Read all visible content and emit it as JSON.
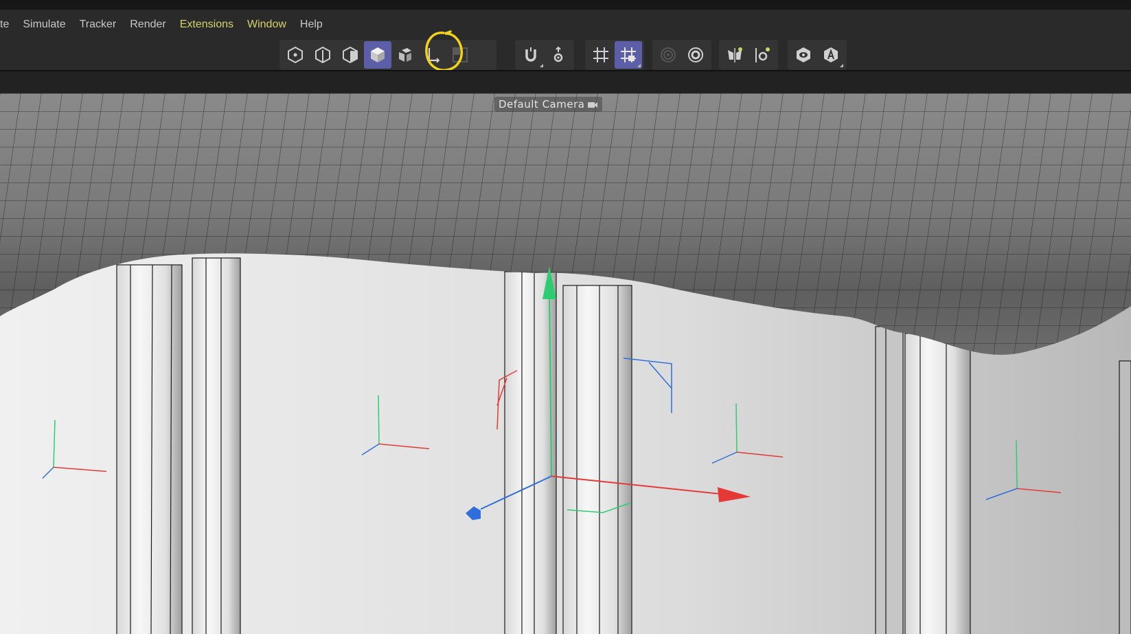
{
  "menu": {
    "items": [
      {
        "label": "te"
      },
      {
        "label": "Simulate"
      },
      {
        "label": "Tracker"
      },
      {
        "label": "Render"
      },
      {
        "label": "Extensions"
      },
      {
        "label": "Window"
      },
      {
        "label": "Help"
      }
    ]
  },
  "toolbar": {
    "groups": [
      {
        "buttons": [
          {
            "icon": "points-mode-icon",
            "active": false
          },
          {
            "icon": "edges-mode-icon",
            "active": false
          },
          {
            "icon": "polygons-mode-icon",
            "active": false
          },
          {
            "icon": "model-mode-icon",
            "active": true
          },
          {
            "icon": "uv-mode-icon",
            "active": false
          },
          {
            "icon": "axis-mode-icon",
            "active": false,
            "annotated": true
          },
          {
            "icon": "texture-mode-icon",
            "active": false
          }
        ]
      },
      {
        "buttons": [
          {
            "icon": "magnet-snap-icon",
            "active": false
          },
          {
            "icon": "snap-settings-icon",
            "active": false
          }
        ]
      },
      {
        "buttons": [
          {
            "icon": "grid-snap-icon",
            "active": false
          },
          {
            "icon": "grid-lock-icon",
            "active": true
          }
        ]
      },
      {
        "buttons": [
          {
            "icon": "soft-selection-icon",
            "active": false
          },
          {
            "icon": "modeling-settings-icon",
            "active": false
          }
        ]
      },
      {
        "buttons": [
          {
            "icon": "symmetry-icon",
            "active": false
          },
          {
            "icon": "symmetry-settings-icon",
            "active": false
          }
        ]
      },
      {
        "buttons": [
          {
            "icon": "view-visibility-icon",
            "active": false
          },
          {
            "icon": "auto-keyframe-icon",
            "active": false
          }
        ]
      }
    ]
  },
  "viewport": {
    "camera_label": "Default Camera",
    "annotation_color": "#f2d21b",
    "axis_colors": {
      "x": "#e53935",
      "y": "#2ecc71",
      "z": "#2f6fdc"
    },
    "accent_color": "#5c5fa8"
  }
}
